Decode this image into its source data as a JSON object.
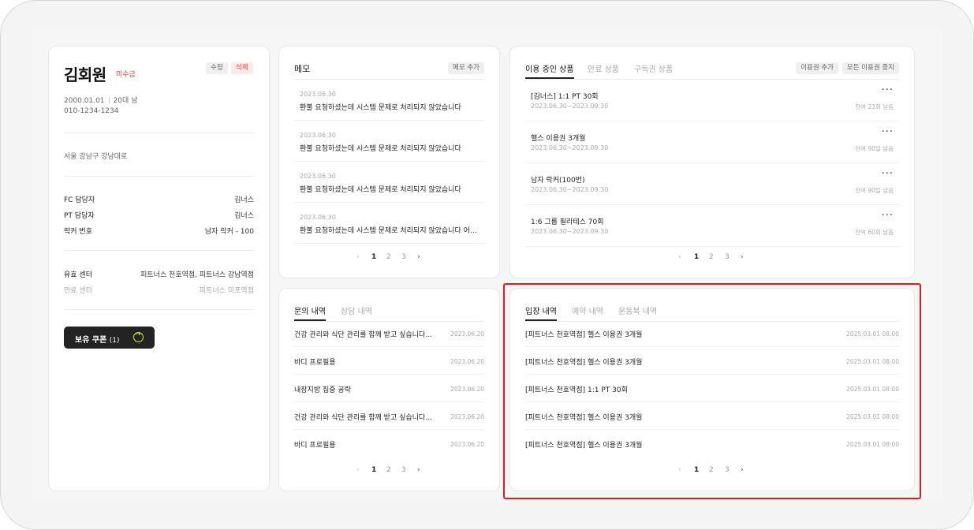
{
  "profile": {
    "name": "김회원",
    "unpaid_badge": "미수금",
    "edit_label": "수정",
    "delete_label": "삭제",
    "birth": "2000.01.01",
    "age_group": "20대 남",
    "phone": "010-1234-1234",
    "address": "서울 강남구 강남대로",
    "fc_manager": {
      "label": "FC 담당자",
      "value": "김너스"
    },
    "pt_manager": {
      "label": "PT 담당자",
      "value": "김너스"
    },
    "locker": {
      "label": "락커 번호",
      "value": "남자 락커 - 100"
    },
    "valid_center": {
      "label": "유효 센터",
      "value": "피트너스 천호역점, 피트너스 강남역점"
    },
    "expired_center": {
      "label": "만료 센터",
      "value": "피트너스 미포역점"
    },
    "coupon_label": "보유 쿠폰",
    "coupon_count": "(1)"
  },
  "memo": {
    "title": "메모",
    "add_label": "메모 추가",
    "items": [
      {
        "date": "2023.06.30",
        "text": "환불 요청하셨는데 시스템 문제로 처리되지 않았습니다"
      },
      {
        "date": "2023.06.30",
        "text": "환불 요청하셨는데 시스템 문제로 처리되지 않았습니다"
      },
      {
        "date": "2023.06.30",
        "text": "환불 요청하셨는데 시스템 문제로 처리되지 않았습니다"
      },
      {
        "date": "2023.06.30",
        "text": "환불 요청하셨는데 시스템 문제로 처리되지 않았습니다 어쩌구..."
      }
    ],
    "pages": [
      "1",
      "2",
      "3"
    ]
  },
  "products": {
    "tabs": [
      "이용 중인 상품",
      "만료 상품",
      "구독권 상품"
    ],
    "add_label": "이용권 추가",
    "stop_all_label": "모든 이용권 중지",
    "items": [
      {
        "name": "[김너스] 1:1 PT 30회",
        "period": "2023.06.30~2023.09.30",
        "remaining": "잔여 23회 남음"
      },
      {
        "name": "헬스 이용권 3개월",
        "period": "2023.06.30~2023.09.30",
        "remaining": "잔여 90일 남음"
      },
      {
        "name": "남자 락커(100번)",
        "period": "2023.06.30~2023.09.30",
        "remaining": "잔여 90일 남음"
      },
      {
        "name": "1:6 그룹 필라테스 70회",
        "period": "2023.06.30~2023.09.30",
        "remaining": "잔여 60회 남음"
      }
    ],
    "pages": [
      "1",
      "2",
      "3"
    ]
  },
  "inquiry": {
    "tabs": [
      "문의 내역",
      "상담 내역"
    ],
    "items": [
      {
        "title": "건강 관리와 식단 관리를 함께 받고 싶습니다람...",
        "date": "2023.06.20"
      },
      {
        "title": "바디 프로필용",
        "date": "2023.06.20"
      },
      {
        "title": "내장지방 집중 공략",
        "date": "2023.06.20"
      },
      {
        "title": "건강 관리와 식단 관리를 함께 받고 싶습니다람...",
        "date": "2023.06.20"
      },
      {
        "title": "바디 프로필용",
        "date": "2023.06.20"
      }
    ],
    "pages": [
      "1",
      "2",
      "3"
    ]
  },
  "entry": {
    "tabs": [
      "입장 내역",
      "예약 내역",
      "운동복 내역"
    ],
    "items": [
      {
        "title": "[피트너스 천호역점] 헬스 이용권 3개월",
        "date": "2025.03.01 08:00"
      },
      {
        "title": "[피트너스 천호역점] 헬스 이용권 3개월",
        "date": "2025.03.01 08:00"
      },
      {
        "title": "[피트너스 천호역점] 1:1 PT 30회",
        "date": "2025.03.01 08:00"
      },
      {
        "title": "[피트너스 천호역점] 헬스 이용권 3개월",
        "date": "2025.03.01 08:00"
      },
      {
        "title": "[피트너스 천호역점] 헬스 이용권 3개월",
        "date": "2025.03.01 08:00"
      }
    ],
    "pages": [
      "1",
      "2",
      "3"
    ]
  },
  "colors": {
    "accent_red": "#e5443b",
    "highlight": "#e21c1c",
    "coupon_icon": "#d4f01e"
  },
  "icons": {
    "more": "more-horizontal-icon",
    "coupon_arrow": "arrow-right-circle-icon",
    "prev": "chevron-left-icon",
    "next": "chevron-right-icon"
  }
}
